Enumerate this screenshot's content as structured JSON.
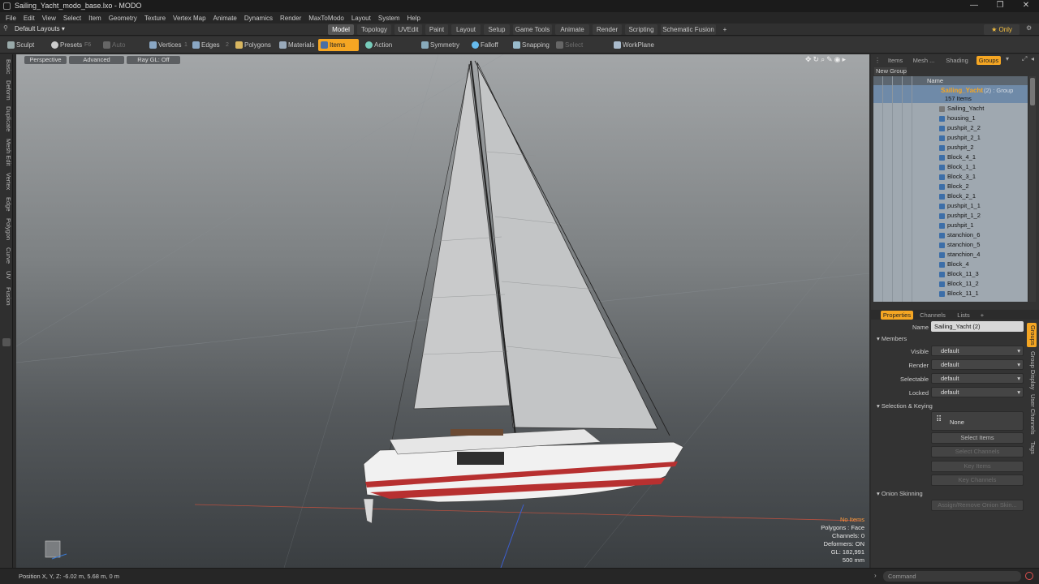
{
  "window": {
    "title": "Sailing_Yacht_modo_base.lxo - MODO",
    "min": "—",
    "max": "❐",
    "close": "✕"
  },
  "menu": [
    "File",
    "Edit",
    "View",
    "Select",
    "Item",
    "Geometry",
    "Texture",
    "Vertex Map",
    "Animate",
    "Dynamics",
    "Render",
    "MaxToModo",
    "Layout",
    "System",
    "Help"
  ],
  "layouts": {
    "default": "Default Layouts ▾",
    "only": "★ Only",
    "tabs": [
      "Model",
      "Topology",
      "UVEdit",
      "Paint",
      "Layout",
      "Setup",
      "Game Tools",
      "Animate",
      "Render",
      "Scripting",
      "Schematic Fusion",
      "+"
    ]
  },
  "toolbar": {
    "sculpt": "Sculpt",
    "presets": "Presets",
    "presets_key": "F6",
    "auto_select": "Auto Select",
    "vertices": "Vertices",
    "vertices_key": "1",
    "edges": "Edges",
    "edges_key": "2",
    "polygons": "Polygons",
    "materials": "Materials",
    "items": "Items",
    "action_center": "Action Center",
    "symmetry": "Symmetry",
    "falloff": "Falloff",
    "snapping": "Snapping",
    "select_through": "Select Through",
    "workplane": "WorkPlane"
  },
  "lefttabs": [
    "Basic",
    "Deform",
    "Duplicate",
    "Mesh Edit",
    "Vertex",
    "Edge",
    "Polygon",
    "Curve",
    "UV",
    "Fusion"
  ],
  "viewport": {
    "perspective": "Perspective",
    "advanced": "Advanced",
    "raygl": "Ray GL: Off",
    "stats": {
      "no_items": "No Items",
      "polygons": "Polygons : Face",
      "channels": "Channels: 0",
      "deformers": "Deformers: ON",
      "gl": "GL: 182,991",
      "scale": "500 mm"
    }
  },
  "status": {
    "position": "Position X, Y, Z:  -6.02 m, 5.68 m, 0 m",
    "command": "Command"
  },
  "itemlist": {
    "tabs": [
      "Items",
      "Mesh ...",
      "Shading",
      "Groups"
    ],
    "new_group": "New Group",
    "name_header": "Name",
    "group": {
      "name": "Sailing_Yacht",
      "suffix": "(2) : Group",
      "count": "157 Items"
    },
    "items": [
      "Sailing_Yacht",
      "housing_1",
      "pushpit_2_2",
      "pushpit_2_1",
      "pushpit_2",
      "Block_4_1",
      "Block_1_1",
      "Block_3_1",
      "Block_2",
      "Block_2_1",
      "pushpit_1_1",
      "pushpit_1_2",
      "pushpit_1",
      "stanchion_6",
      "stanchion_5",
      "stanchion_4",
      "Block_4",
      "Block_11_3",
      "Block_11_2",
      "Block_11_1"
    ]
  },
  "properties": {
    "tabs": [
      "Properties",
      "Channels",
      "Lists",
      "+"
    ],
    "name_label": "Name",
    "name_value": "Sailing_Yacht (2)",
    "members": "Members",
    "visible": "Visible",
    "render": "Render",
    "selectable": "Selectable",
    "locked": "Locked",
    "default": "default",
    "selection_keying": "Selection & Keying",
    "none": "None",
    "select_items": "Select Items",
    "select_channels": "Select Channels",
    "key_items": "Key Items",
    "key_channels": "Key Channels",
    "onion": "Onion Skinning",
    "assign_onion": "Assign/Remove Onion Skin...",
    "sidetabs": [
      "Groups",
      "Group Display",
      "User Channels",
      "Tags"
    ]
  }
}
